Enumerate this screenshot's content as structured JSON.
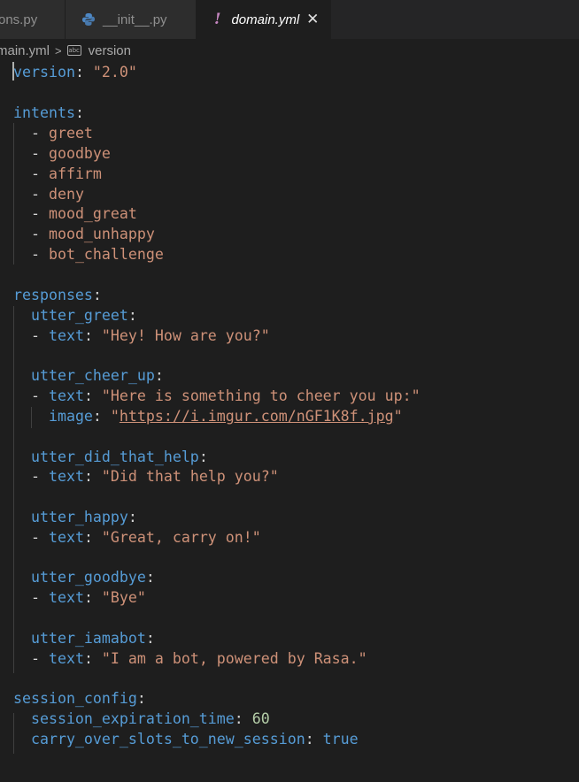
{
  "tabs": [
    {
      "label": "ons.py",
      "active": false
    },
    {
      "label": "__init__.py",
      "active": false
    },
    {
      "label": "domain.yml",
      "active": true
    }
  ],
  "breadcrumb": {
    "file": "main.yml",
    "symbol": "version",
    "symbol_icon": "abc-string-icon"
  },
  "colors": {
    "keyword": "#569cd6",
    "string": "#ce9178",
    "number": "#b5cea8",
    "yml_icon": "#c586c0"
  },
  "code": {
    "version_key": "version",
    "version_val": "\"2.0\"",
    "intents_key": "intents",
    "intents": [
      "greet",
      "goodbye",
      "affirm",
      "deny",
      "mood_great",
      "mood_unhappy",
      "bot_challenge"
    ],
    "responses_key": "responses",
    "text_key": "text",
    "image_key": "image",
    "responses": [
      {
        "name": "utter_greet",
        "text": "\"Hey! How are you?\""
      },
      {
        "name": "utter_cheer_up",
        "text": "\"Here is something to cheer you up:\"",
        "image": "https://i.imgur.com/nGF1K8f.jpg"
      },
      {
        "name": "utter_did_that_help",
        "text": "\"Did that help you?\""
      },
      {
        "name": "utter_happy",
        "text": "\"Great, carry on!\""
      },
      {
        "name": "utter_goodbye",
        "text": "\"Bye\""
      },
      {
        "name": "utter_iamabot",
        "text": "\"I am a bot, powered by Rasa.\""
      }
    ],
    "session_key": "session_config",
    "expiration_key": "session_expiration_time",
    "expiration_val": "60",
    "carry_key": "carry_over_slots_to_new_session",
    "carry_val": "true"
  }
}
